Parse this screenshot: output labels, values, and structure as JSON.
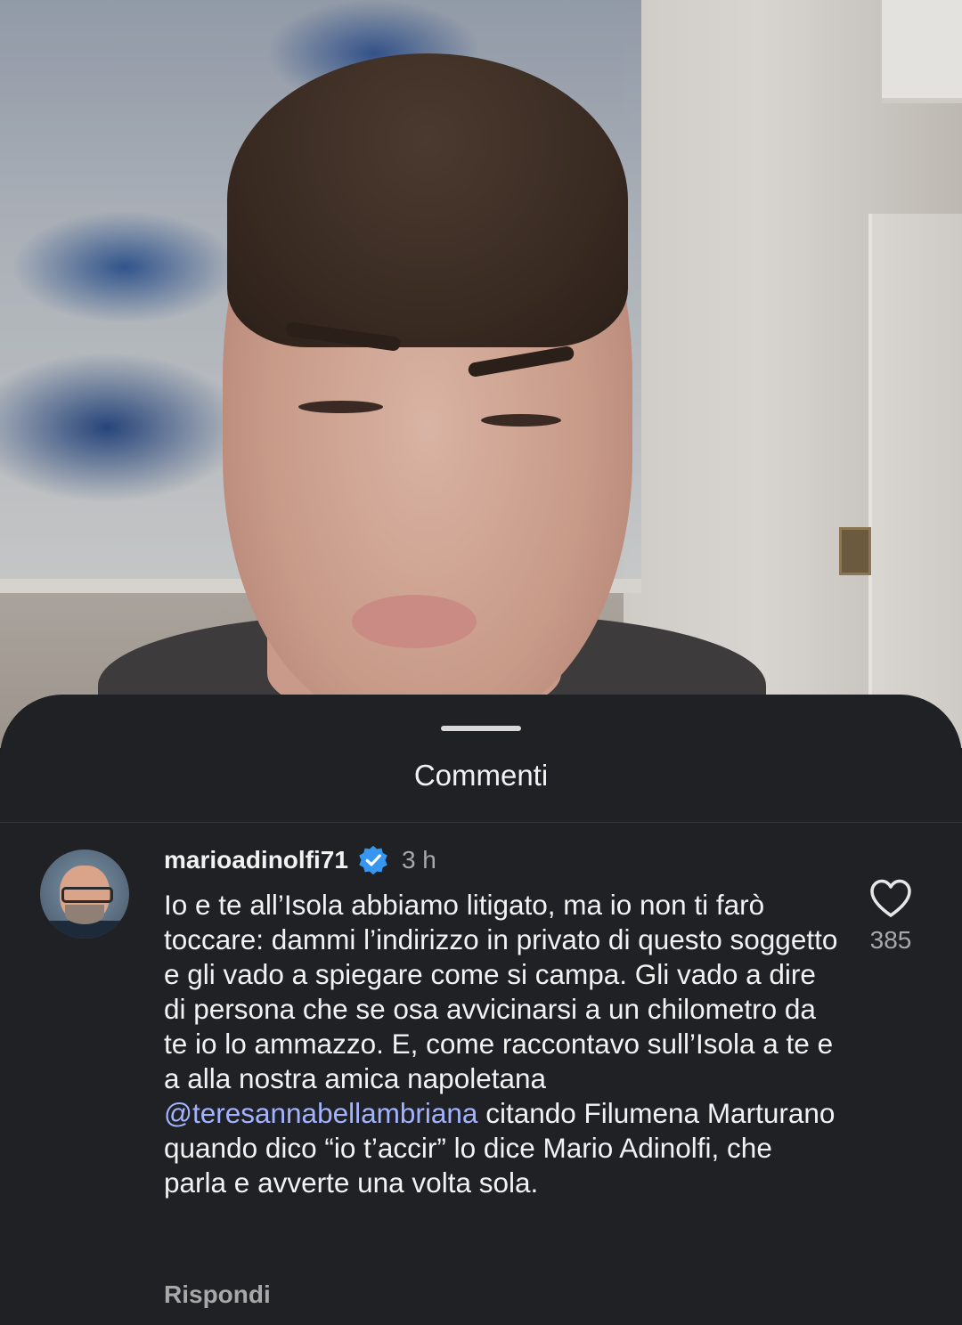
{
  "video": {
    "description_icon": "video-frame"
  },
  "sheet": {
    "title": "Commenti"
  },
  "comment": {
    "username": "marioadinolfi71",
    "verified_icon": "verified-badge-icon",
    "time": "3 h",
    "text_before_mention": "Io e te all’Isola abbiamo litigato, ma io non ti farò toccare: dammi l’indirizzo in privato di questo soggetto e gli vado a spiegare come si campa. Gli vado a dire di persona che se osa avvicinarsi a un chilometro da te io lo ammazzo. E, come raccontavo sull’Isola a te e a alla nostra amica napoletana ",
    "mention": "@teresannabellambriana",
    "text_after_mention": " citando Filumena Marturano quando dico “io t’accir” lo dice Mario Adinolfi, che parla e avverte una volta sola.",
    "reply_label": "Rispondi",
    "like_count": "385",
    "like_icon": "heart-icon"
  },
  "colors": {
    "sheet_bg": "#1f2125",
    "text": "#f2f2f2",
    "muted": "#a8a8a8",
    "mention": "#a3b3ff",
    "verified": "#3797f0"
  }
}
